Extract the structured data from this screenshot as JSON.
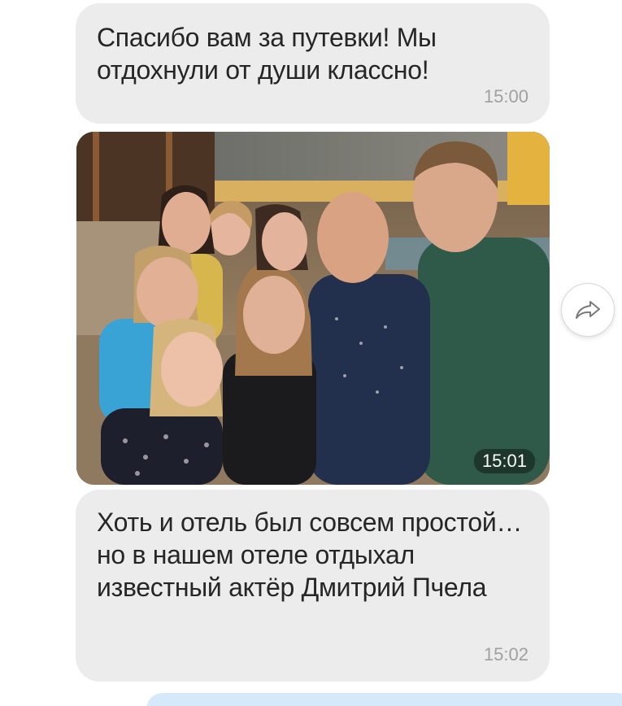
{
  "messages": [
    {
      "type": "text",
      "text": "Спасибо вам за путевки! Мы отдохнули от души классно!",
      "time": "15:00"
    },
    {
      "type": "photo",
      "time": "15:01"
    },
    {
      "type": "text",
      "text": "Хоть и отель был совсем простой… но в нашем отеле отдыхал известный актёр Дмитрий Пчела",
      "time": "15:02"
    }
  ],
  "share_button": {
    "icon": "forward-arrow-icon"
  },
  "colors": {
    "incoming_bubble": "#ececec",
    "outgoing_bubble": "#d6e9fb",
    "timestamp": "#a0a0a0"
  }
}
